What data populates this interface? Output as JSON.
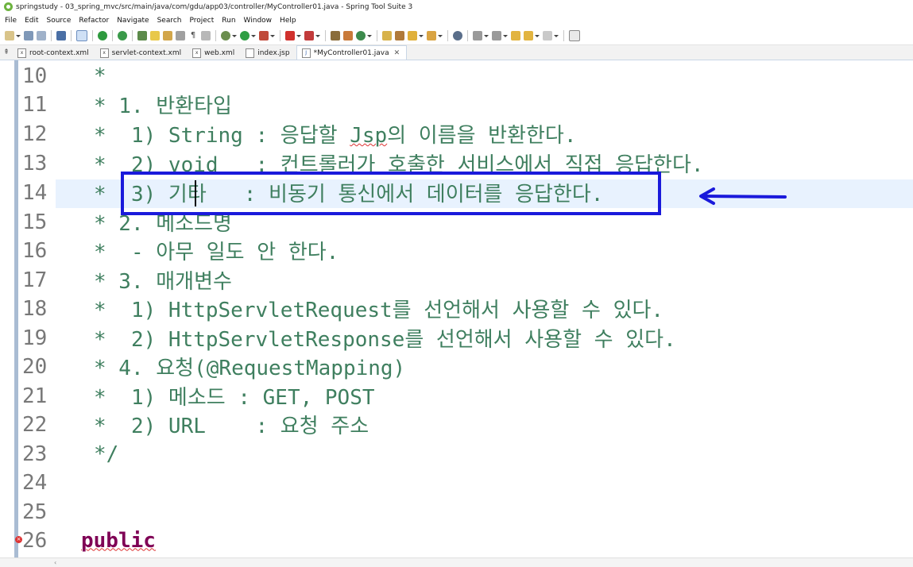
{
  "window": {
    "title": "springstudy - 03_spring_mvc/src/main/java/com/gdu/app03/controller/MyController01.java - Spring Tool Suite 3"
  },
  "menu": [
    "File",
    "Edit",
    "Source",
    "Refactor",
    "Navigate",
    "Search",
    "Project",
    "Run",
    "Window",
    "Help"
  ],
  "tabs": [
    {
      "label": "root-context.xml",
      "icon": "xml-file-icon",
      "active": false
    },
    {
      "label": "servlet-context.xml",
      "icon": "xml-file-icon",
      "active": false
    },
    {
      "label": "web.xml",
      "icon": "xml-file-icon",
      "active": false
    },
    {
      "label": "index.jsp",
      "icon": "jsp-file-icon",
      "active": false
    },
    {
      "label": "*MyController01.java",
      "icon": "java-file-icon",
      "active": true
    }
  ],
  "editor": {
    "lines": [
      {
        "num": "10",
        "text": "*"
      },
      {
        "num": "11",
        "text": "* 1. 반환타입"
      },
      {
        "num": "12",
        "pre": "*  1) String : 응답할 ",
        "squiggle": "Jsp",
        "post": "의 이름을 반환한다."
      },
      {
        "num": "13",
        "text": "*  2) void   : 컨트롤러가 호출한 서비스에서 직접 응답한다."
      },
      {
        "num": "14",
        "text": "*  3) 기타   : 비동기 통신에서 데이터를 응답한다."
      },
      {
        "num": "15",
        "text": "* 2. 메소드명"
      },
      {
        "num": "16",
        "text": "*  - 아무 일도 안 한다."
      },
      {
        "num": "17",
        "text": "* 3. 매개변수"
      },
      {
        "num": "18",
        "text": "*  1) HttpServletRequest를 선언해서 사용할 수 있다."
      },
      {
        "num": "19",
        "text": "*  2) HttpServletResponse를 선언해서 사용할 수 있다."
      },
      {
        "num": "20",
        "text": "* 4. 요청(@RequestMapping)"
      },
      {
        "num": "21",
        "text": "*  1) 메소드 : GET, POST"
      },
      {
        "num": "22",
        "text": "*  2) URL    : 요청 주소"
      },
      {
        "num": "23",
        "text": "*/"
      },
      {
        "num": "24",
        "text": ""
      },
      {
        "num": "25",
        "text": ""
      },
      {
        "num": "26",
        "keyword": "public"
      }
    ]
  },
  "colors": {
    "comment": "#3f7f5f",
    "keyword": "#7f0055",
    "line_number": "#787878",
    "annotation": "#1a1adb",
    "current_line": "#e8f2fe"
  }
}
